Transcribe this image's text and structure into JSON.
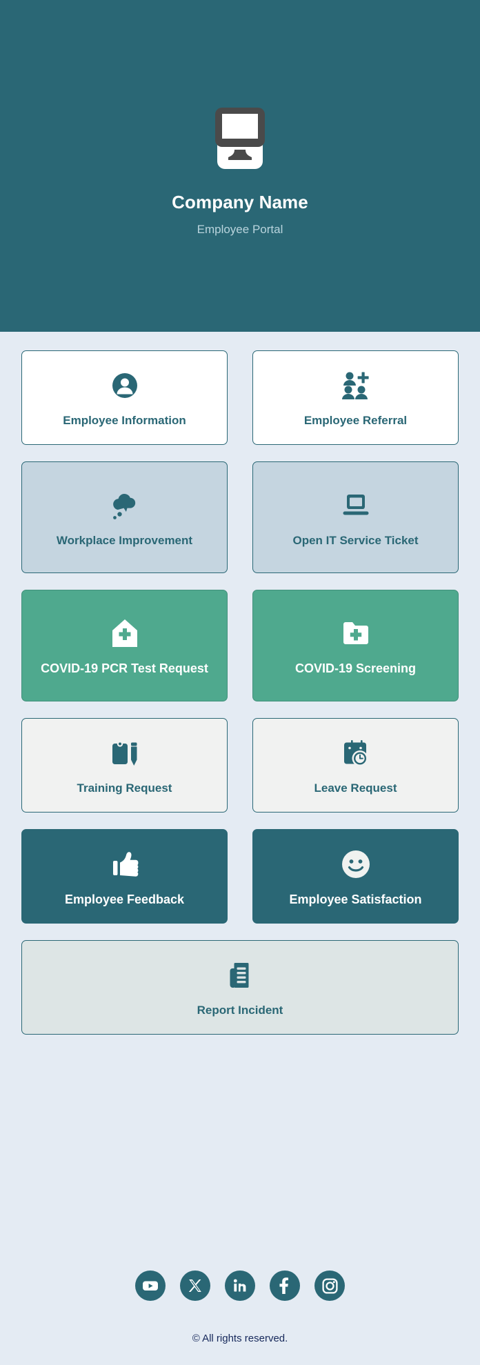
{
  "header": {
    "logo_icon": "desktop-monitor-icon",
    "company_name": "Company Name",
    "subtitle": "Employee Portal",
    "background_color": "#2a6775",
    "title_color": "#ffffff",
    "subtitle_color": "#b9d4dd"
  },
  "theme": {
    "page_background": "#e4ebf3",
    "brand_teal": "#2a6775",
    "accent_green": "#4fa98e",
    "card_bluegray": "#c5d5e0",
    "card_lightgray": "#f1f2f1",
    "card_palegray": "#dde5e5",
    "copyright_color": "#16285a"
  },
  "cards": [
    {
      "label": "Employee Information",
      "icon": "user-circle-icon",
      "variant": "v-white",
      "icon_color": "#2a6775",
      "name": "card-employee-information"
    },
    {
      "label": "Employee Referral",
      "icon": "user-add-group-icon",
      "variant": "v-white",
      "icon_color": "#2a6775",
      "name": "card-employee-referral"
    },
    {
      "label": "Workplace Improvement",
      "icon": "thought-bubble-icon",
      "variant": "v-bluegray",
      "icon_color": "#2a6775",
      "name": "card-workplace-improvement"
    },
    {
      "label": "Open IT Service Ticket",
      "icon": "laptop-icon",
      "variant": "v-bluegray",
      "icon_color": "#2a6775",
      "name": "card-open-it-service-ticket"
    },
    {
      "label": "COVID-19 PCR Test Request",
      "icon": "hospital-house-cross-icon",
      "variant": "v-green",
      "icon_color": "#ffffff",
      "name": "card-covid-19-pcr-test-request"
    },
    {
      "label": "COVID-19 Screening",
      "icon": "folder-cross-icon",
      "variant": "v-green",
      "icon_color": "#ffffff",
      "name": "card-covid-19-screening"
    },
    {
      "label": "Training Request",
      "icon": "clipboard-pencil-icon",
      "variant": "v-lightgray",
      "icon_color": "#2a6775",
      "name": "card-training-request"
    },
    {
      "label": "Leave Request",
      "icon": "calendar-clock-icon",
      "variant": "v-lightgray",
      "icon_color": "#2a6775",
      "name": "card-leave-request"
    },
    {
      "label": "Employee Feedback",
      "icon": "thumbs-up-icon",
      "variant": "v-darkteal",
      "icon_color": "#ffffff",
      "name": "card-employee-feedback"
    },
    {
      "label": "Employee Satisfaction",
      "icon": "smiley-face-icon",
      "variant": "v-darkteal",
      "icon_color": "#ffffff",
      "name": "card-employee-satisfaction"
    },
    {
      "label": "Report Incident",
      "icon": "document-report-icon",
      "variant": "v-palegray",
      "icon_color": "#2a6775",
      "name": "card-report-incident"
    }
  ],
  "footer": {
    "social": [
      {
        "name": "youtube",
        "label": "YouTube"
      },
      {
        "name": "x-twitter",
        "label": "X"
      },
      {
        "name": "linkedin",
        "label": "LinkedIn"
      },
      {
        "name": "facebook",
        "label": "Facebook"
      },
      {
        "name": "instagram",
        "label": "Instagram"
      }
    ],
    "copyright": "© All rights reserved."
  }
}
